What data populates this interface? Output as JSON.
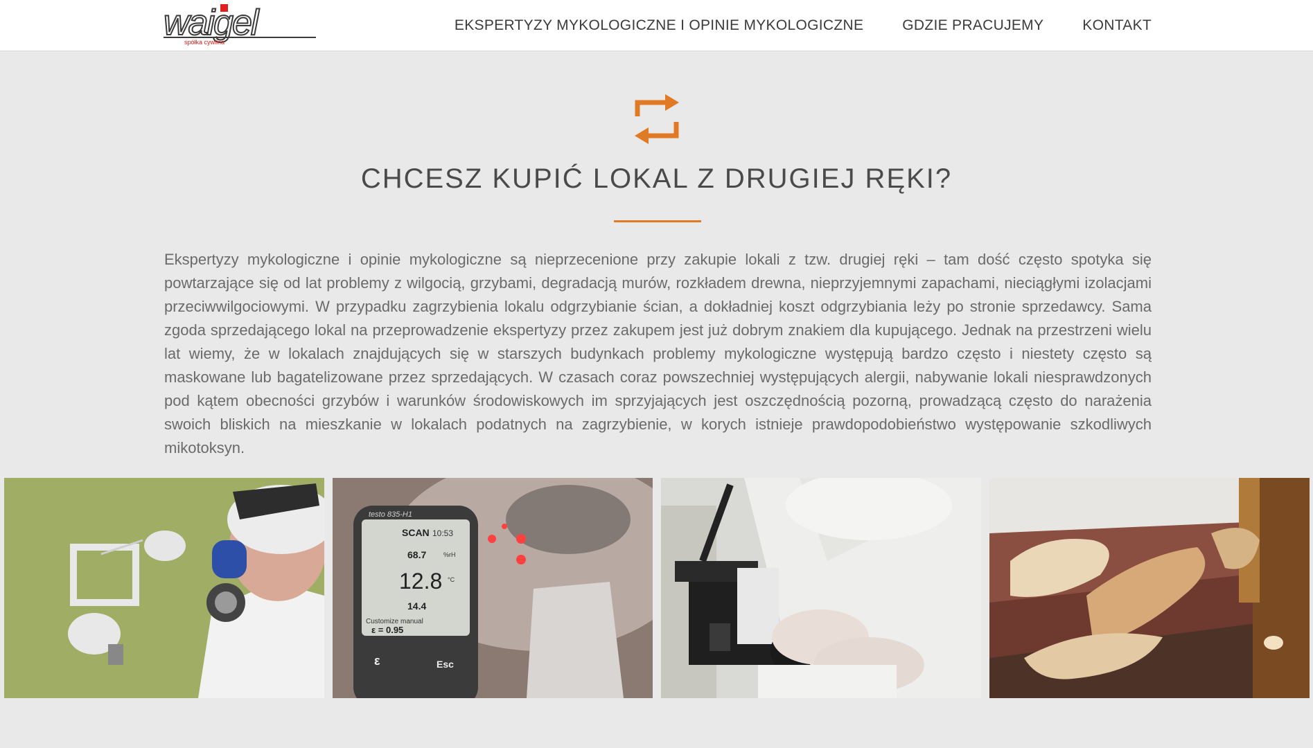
{
  "header": {
    "logo_text": "waigel",
    "logo_subtext": "spółka cywilna",
    "nav": [
      {
        "label": "EKSPERTYZY MYKOLOGICZNE I OPINIE MYKOLOGICZNE"
      },
      {
        "label": "GDZIE PRACUJEMY"
      },
      {
        "label": "KONTAKT"
      }
    ]
  },
  "section": {
    "icon": "retweet-arrows-icon",
    "title": "CHCESZ KUPIĆ LOKAL Z DRUGIEJ RĘKI?",
    "body": "Ekspertyzy mykologiczne i opinie mykologiczne są nieprzecenione przy zakupie lokali z tzw. drugiej ręki – tam dość często spotyka się powtarzające się od lat problemy z wilgocią, grzybami, degradacją murów, rozkładem drewna, nieprzyjemnymi zapachami, nieciągłymi izolacjami przeciwwilgociowymi. W przypadku zagrzybienia lokalu odgrzybianie ścian, a dokładniej koszt odgrzybiania leży po stronie sprzedawcy. Sama zgoda sprzedającego lokal na przeprowadzenie ekspertyzy przez zakupem jest już dobrym znakiem dla kupującego. Jednak na przestrzeni wielu lat wiemy, że w lokalach znajdujących się w starszych budynkach problemy mykologiczne występują bardzo często i niestety często są maskowane lub bagatelizowane przez sprzedających. W czasach coraz powszechniej występujących alergii, nabywanie lokali niesprawdzonych pod kątem obecności grzybów i warunków środowiskowych im sprzyjających jest oszczędnością pozorną, prowadzącą często do narażenia swoich bliskich na mieszkanie w lokalach podatnych na zagrzybienie, w korych istnieje prawdopodobieństwo występowanie szkodliwych mikotoksyn."
  },
  "gallery": {
    "thermometer": {
      "model": "testo 835-H1",
      "mode": "SCAN",
      "time": "10:53",
      "reading_top": "68.7",
      "reading_main": "12.8",
      "reading_low": "14.4",
      "unit_rh": "%rH",
      "unit_c": "°C",
      "customize": "Customize manual",
      "emissivity": "ε = 0.95",
      "key_left": "ε",
      "key_right": "Esc"
    }
  },
  "colors": {
    "accent": "#e07a24",
    "logo_red": "#e0201c",
    "background": "#e9e9e9"
  }
}
